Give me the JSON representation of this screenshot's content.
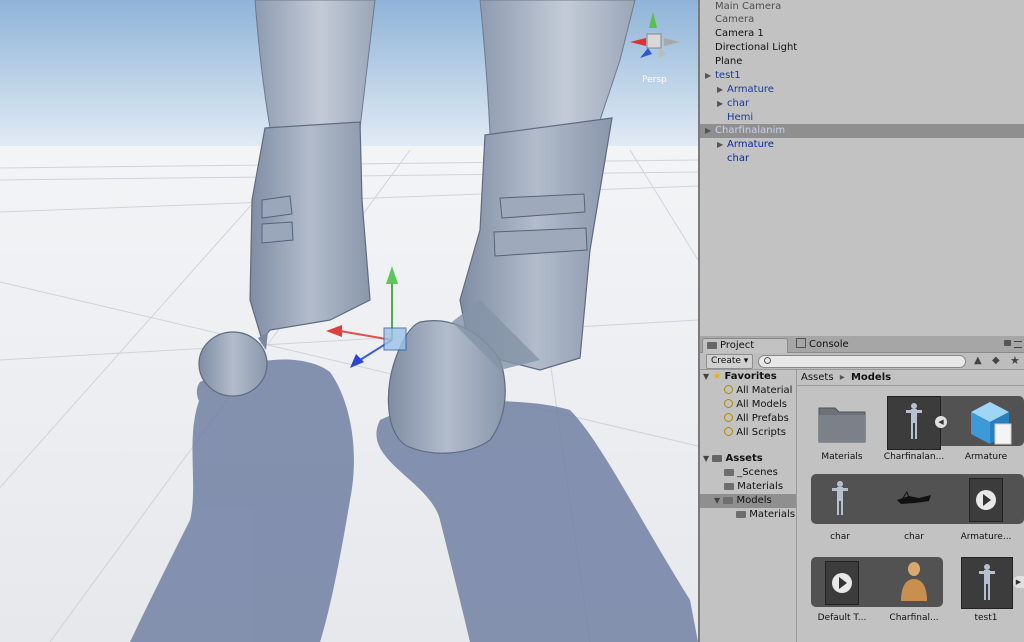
{
  "scene_view": {
    "gizmo_label": "Persp"
  },
  "hierarchy": {
    "items": [
      {
        "label": "Main Camera",
        "indent": 0,
        "expandable": false,
        "color": "#505050",
        "selected": false
      },
      {
        "label": "Camera",
        "indent": 0,
        "expandable": false,
        "color": "#505050",
        "selected": false
      },
      {
        "label": "Camera 1",
        "indent": 0,
        "expandable": false,
        "color": "#111111",
        "selected": false
      },
      {
        "label": "Directional Light",
        "indent": 0,
        "expandable": false,
        "color": "#111111",
        "selected": false
      },
      {
        "label": "Plane",
        "indent": 0,
        "expandable": false,
        "color": "#111111",
        "selected": false
      },
      {
        "label": "test1",
        "indent": 0,
        "expandable": true,
        "color": "#1a3b9c",
        "selected": false
      },
      {
        "label": "Armature",
        "indent": 1,
        "expandable": true,
        "color": "#1a3b9c",
        "selected": false
      },
      {
        "label": "char",
        "indent": 1,
        "expandable": true,
        "color": "#1a3b9c",
        "selected": false
      },
      {
        "label": "Hemi",
        "indent": 1,
        "expandable": false,
        "color": "#1a3b9c",
        "selected": false
      },
      {
        "label": "Charfinalanim",
        "indent": 0,
        "expandable": true,
        "color": "#c8d2f0",
        "selected": true
      },
      {
        "label": "Armature",
        "indent": 1,
        "expandable": true,
        "color": "#0a2a9a",
        "selected": false
      },
      {
        "label": "char",
        "indent": 1,
        "expandable": false,
        "color": "#0a2a9a",
        "selected": false
      }
    ]
  },
  "project": {
    "tabs": {
      "project": "Project",
      "console": "Console"
    },
    "create_label": "Create ▾",
    "favorites": {
      "title": "Favorites",
      "items": [
        "All Material",
        "All Models",
        "All Prefabs",
        "All Scripts"
      ]
    },
    "assets_tree": {
      "title": "Assets",
      "items": [
        {
          "label": "_Scenes",
          "level": 1,
          "selected": false
        },
        {
          "label": "Materials",
          "level": 1,
          "selected": false
        },
        {
          "label": "Models",
          "level": 1,
          "selected": true
        },
        {
          "label": "Materials",
          "level": 2,
          "selected": false
        }
      ]
    },
    "breadcrumb": {
      "root": "Assets",
      "separator": "▸",
      "current": "Models"
    },
    "grid": [
      {
        "label": "Materials",
        "kind": "folder"
      },
      {
        "label": "Charfinalan...",
        "kind": "model"
      },
      {
        "label": "Armature",
        "kind": "cube"
      },
      {
        "label": "char",
        "kind": "model"
      },
      {
        "label": "char",
        "kind": "mesh"
      },
      {
        "label": "Armature...",
        "kind": "anim"
      },
      {
        "label": "Default T...",
        "kind": "anim"
      },
      {
        "label": "Charfinal...",
        "kind": "avatar"
      },
      {
        "label": "test1",
        "kind": "model"
      }
    ]
  }
}
